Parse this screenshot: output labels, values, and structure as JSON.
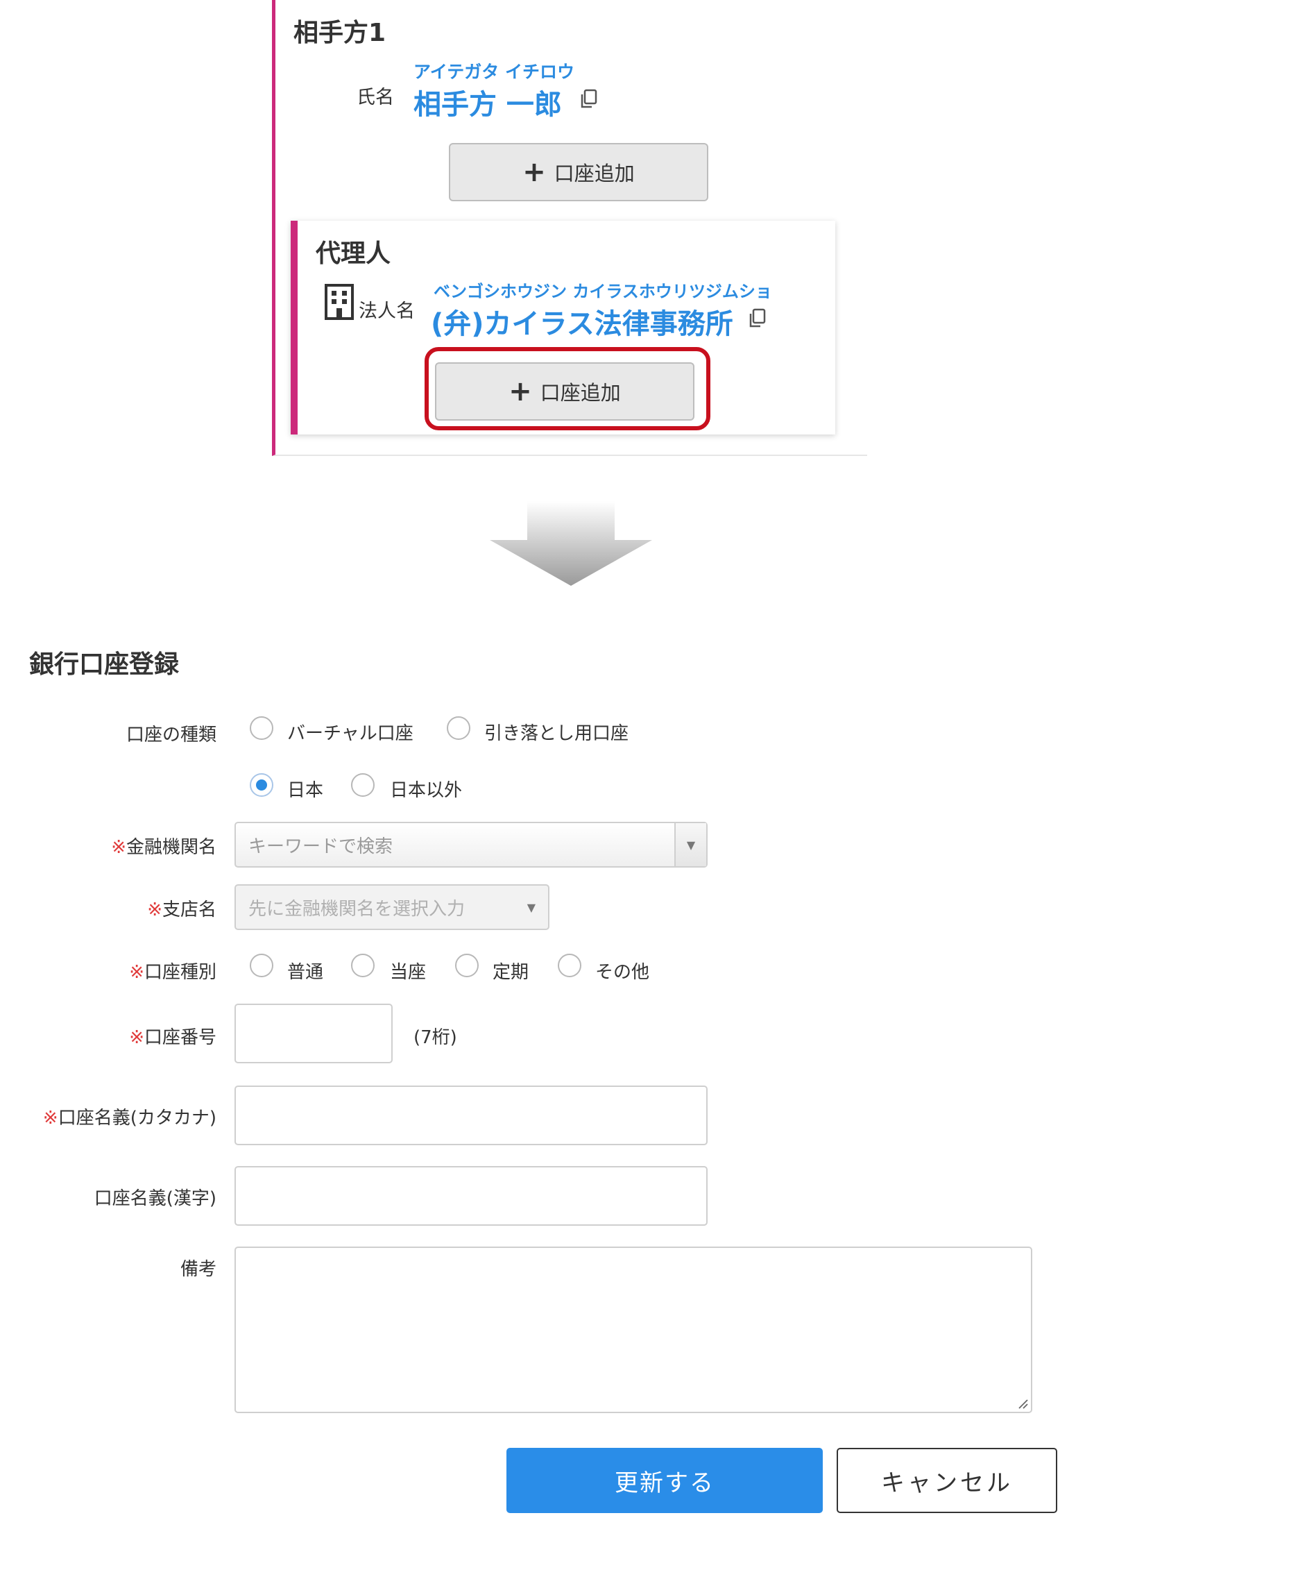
{
  "party": {
    "title": "相手方1",
    "name_label": "氏名",
    "name_kana": "アイテガタ イチロウ",
    "name": "相手方 一郎",
    "add_account_label": "口座追加"
  },
  "agent": {
    "title": "代理人",
    "corp_label": "法人名",
    "corp_kana": "ベンゴシホウジン カイラスホウリツジムショ",
    "corp_name": "(弁)カイラス法律事務所",
    "add_account_label": "口座追加"
  },
  "form": {
    "title": "銀行口座登録",
    "account_kind": {
      "label": "口座の種類",
      "options": [
        "バーチャル口座",
        "引き落とし用口座"
      ]
    },
    "country": {
      "options": [
        "日本",
        "日本以外"
      ],
      "selected": "日本"
    },
    "bank": {
      "req_mark": "※",
      "label": "金融機関名",
      "placeholder": "キーワードで検索"
    },
    "branch": {
      "req_mark": "※",
      "label": "支店名",
      "placeholder": "先に金融機関名を選択入力"
    },
    "account_type": {
      "req_mark": "※",
      "label": "口座種別",
      "options": [
        "普通",
        "当座",
        "定期",
        "その他"
      ]
    },
    "account_number": {
      "req_mark": "※",
      "label": "口座番号",
      "hint": "(7桁)"
    },
    "holder_kana": {
      "req_mark": "※",
      "label": "口座名義(カタカナ)"
    },
    "holder_kanji": {
      "label": "口座名義(漢字)"
    },
    "remarks": {
      "label": "備考"
    },
    "submit_label": "更新する",
    "cancel_label": "キャンセル"
  },
  "colors": {
    "accent_border": "#cc2a7b",
    "link_blue": "#2b8be0",
    "primary_button": "#2a8de8",
    "highlight_red": "#c8101e",
    "required_red": "#e03a3a"
  },
  "icons": {
    "copy": "copy-icon",
    "building": "building-icon",
    "plus": "plus-icon",
    "arrow": "down-arrow-icon",
    "dropdown": "chevron-down-icon"
  }
}
